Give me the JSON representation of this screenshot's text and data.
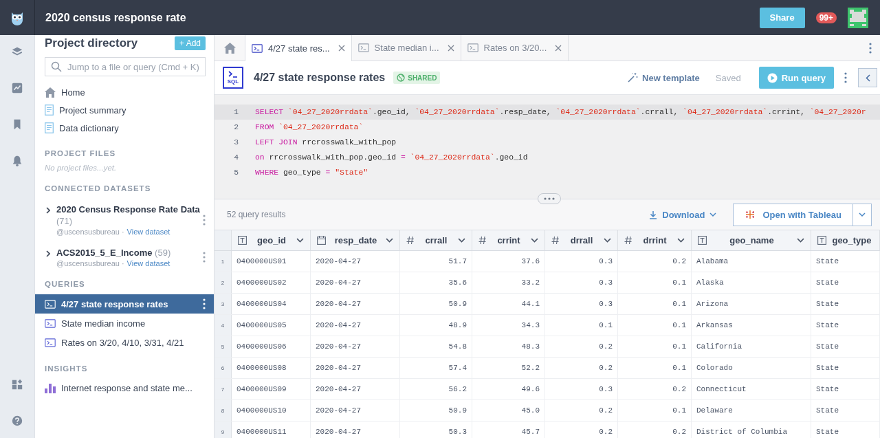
{
  "app": {
    "title": "2020 census response rate",
    "share": "Share",
    "notifications": "99+"
  },
  "sidebar": {
    "heading": "Project directory",
    "add": "+ Add",
    "search": {
      "placeholder": "Jump to a file or query (Cmd + K)"
    },
    "nav": [
      {
        "kind": "home",
        "label": "Home"
      },
      {
        "kind": "doc",
        "label": "Project summary"
      },
      {
        "kind": "doc",
        "label": "Data dictionary"
      }
    ],
    "project_files": {
      "title": "PROJECT FILES",
      "empty": "No project files...yet."
    },
    "datasets": {
      "title": "CONNECTED DATASETS",
      "items": [
        {
          "name": "2020 Census Response Rate Data",
          "count": "(71)",
          "owner": "@uscensusbureau ·",
          "link": "View dataset"
        },
        {
          "name": "ACS2015_5_E_Income",
          "count": "(59)",
          "owner": "@uscensusbureau ·",
          "link": "View dataset"
        }
      ]
    },
    "queries": {
      "title": "QUERIES",
      "items": [
        {
          "label": "4/27 state response rates",
          "selected": true
        },
        {
          "label": "State median income",
          "selected": false
        },
        {
          "label": "Rates on 3/20, 4/10, 3/31, 4/21",
          "selected": false
        }
      ]
    },
    "insights": {
      "title": "INSIGHTS",
      "items": [
        {
          "label": "Internet response and state me..."
        }
      ]
    }
  },
  "tabs": [
    {
      "kind": "home",
      "selected": false
    },
    {
      "kind": "query",
      "label": "4/27 state res...",
      "selected": true
    },
    {
      "kind": "query",
      "label": "State median i...",
      "selected": false
    },
    {
      "kind": "query",
      "label": "Rates on 3/20...",
      "selected": false
    }
  ],
  "query": {
    "icon_label": "SQL",
    "title": "4/27 state response rates",
    "badge": "SHARED",
    "new_template": "New template",
    "status": "Saved",
    "run": "Run query"
  },
  "editor": {
    "lines": [
      {
        "number": "1",
        "active": true,
        "tokens": [
          {
            "kind": "kw",
            "text": "SELECT "
          },
          {
            "kind": "str",
            "text": "`04_27_2020rrdata`"
          },
          {
            "kind": "plain",
            "text": ".geo_id, "
          },
          {
            "kind": "str",
            "text": "`04_27_2020rrdata`"
          },
          {
            "kind": "plain",
            "text": ".resp_date, "
          },
          {
            "kind": "str",
            "text": "`04_27_2020rrdata`"
          },
          {
            "kind": "plain",
            "text": ".crrall, "
          },
          {
            "kind": "str",
            "text": "`04_27_2020rrdata`"
          },
          {
            "kind": "plain",
            "text": ".crrint, "
          },
          {
            "kind": "str",
            "text": "`04_27_2020r"
          }
        ]
      },
      {
        "number": "2",
        "active": false,
        "tokens": [
          {
            "kind": "kw",
            "text": "FROM "
          },
          {
            "kind": "str",
            "text": "`04_27_2020rrdata`"
          }
        ]
      },
      {
        "number": "3",
        "active": false,
        "tokens": [
          {
            "kind": "kw",
            "text": "LEFT JOIN"
          },
          {
            "kind": "plain",
            "text": " rrcrosswalk_with_pop"
          }
        ]
      },
      {
        "number": "4",
        "active": false,
        "tokens": [
          {
            "kind": "kw",
            "text": "on"
          },
          {
            "kind": "plain",
            "text": " rrcrosswalk_with_pop.geo_id "
          },
          {
            "kind": "kw",
            "text": "= "
          },
          {
            "kind": "str",
            "text": "`04_27_2020rrdata`"
          },
          {
            "kind": "plain",
            "text": ".geo_id"
          }
        ]
      },
      {
        "number": "5",
        "active": false,
        "tokens": [
          {
            "kind": "kw",
            "text": "WHERE"
          },
          {
            "kind": "plain",
            "text": " geo_type "
          },
          {
            "kind": "kw",
            "text": "= "
          },
          {
            "kind": "str",
            "text": "\"State\""
          }
        ]
      }
    ]
  },
  "results": {
    "count": "52 query results",
    "download": "Download",
    "open_with": "Open with Tableau"
  },
  "table": {
    "columns": [
      {
        "name": "geo_id",
        "kind": "text",
        "menu": true
      },
      {
        "name": "resp_date",
        "kind": "date",
        "menu": true
      },
      {
        "name": "crrall",
        "kind": "number",
        "menu": true
      },
      {
        "name": "crrint",
        "kind": "number",
        "menu": true
      },
      {
        "name": "drrall",
        "kind": "number",
        "menu": true
      },
      {
        "name": "drrint",
        "kind": "number",
        "menu": true
      },
      {
        "name": "geo_name",
        "kind": "text",
        "menu": true
      },
      {
        "name": "geo_type",
        "kind": "text",
        "menu": false
      }
    ],
    "rows": [
      {
        "number": "1",
        "cells": [
          "0400000US01",
          "2020-04-27",
          "51.7",
          "37.6",
          "0.3",
          "0.2",
          "Alabama",
          "State"
        ]
      },
      {
        "number": "2",
        "cells": [
          "0400000US02",
          "2020-04-27",
          "35.6",
          "33.2",
          "0.3",
          "0.1",
          "Alaska",
          "State"
        ]
      },
      {
        "number": "3",
        "cells": [
          "0400000US04",
          "2020-04-27",
          "50.9",
          "44.1",
          "0.3",
          "0.1",
          "Arizona",
          "State"
        ]
      },
      {
        "number": "4",
        "cells": [
          "0400000US05",
          "2020-04-27",
          "48.9",
          "34.3",
          "0.1",
          "0.1",
          "Arkansas",
          "State"
        ]
      },
      {
        "number": "5",
        "cells": [
          "0400000US06",
          "2020-04-27",
          "54.8",
          "48.3",
          "0.2",
          "0.1",
          "California",
          "State"
        ]
      },
      {
        "number": "6",
        "cells": [
          "0400000US08",
          "2020-04-27",
          "57.4",
          "52.2",
          "0.2",
          "0.1",
          "Colorado",
          "State"
        ]
      },
      {
        "number": "7",
        "cells": [
          "0400000US09",
          "2020-04-27",
          "56.2",
          "49.6",
          "0.3",
          "0.2",
          "Connecticut",
          "State"
        ]
      },
      {
        "number": "8",
        "cells": [
          "0400000US10",
          "2020-04-27",
          "50.9",
          "45.0",
          "0.2",
          "0.1",
          "Delaware",
          "State"
        ]
      },
      {
        "number": "9",
        "cells": [
          "0400000US11",
          "2020-04-27",
          "50.3",
          "45.7",
          "0.2",
          "0.2",
          "District of Columbia",
          "State"
        ]
      }
    ]
  }
}
